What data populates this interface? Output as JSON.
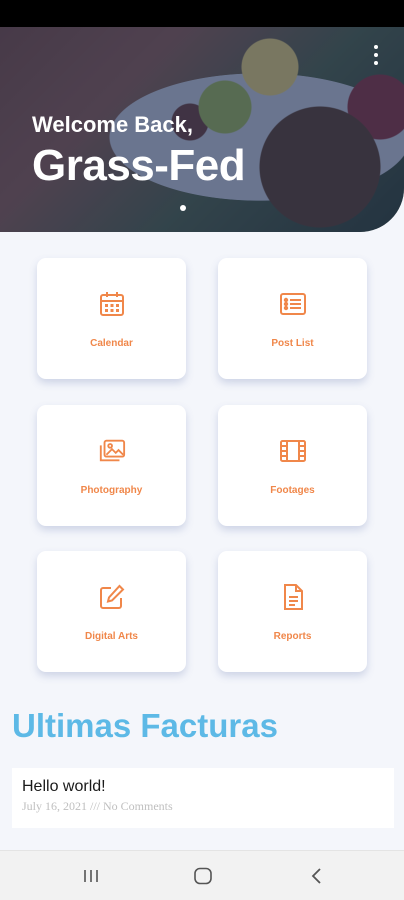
{
  "hero": {
    "welcome": "Welcome Back,",
    "name": "Grass-Fed",
    "more_icon": "more-vertical-icon"
  },
  "menu": [
    {
      "label": "Calendar",
      "icon": "calendar-icon"
    },
    {
      "label": "Post List",
      "icon": "list-icon"
    },
    {
      "label": "Photography",
      "icon": "images-icon"
    },
    {
      "label": "Footages",
      "icon": "film-icon"
    },
    {
      "label": "Digital Arts",
      "icon": "edit-icon"
    },
    {
      "label": "Reports",
      "icon": "document-icon"
    }
  ],
  "section": {
    "title": "Ultimas Facturas"
  },
  "posts": [
    {
      "title": "Hello world!",
      "meta": "July 16, 2021 /// No Comments"
    }
  ],
  "colors": {
    "accent": "#f0874a",
    "section_title": "#5db9e6",
    "hero_overlay": "#1e2d5a",
    "background": "#f4f6fb"
  },
  "nav": {
    "icons": [
      "recent-apps-icon",
      "home-icon",
      "back-icon"
    ]
  }
}
